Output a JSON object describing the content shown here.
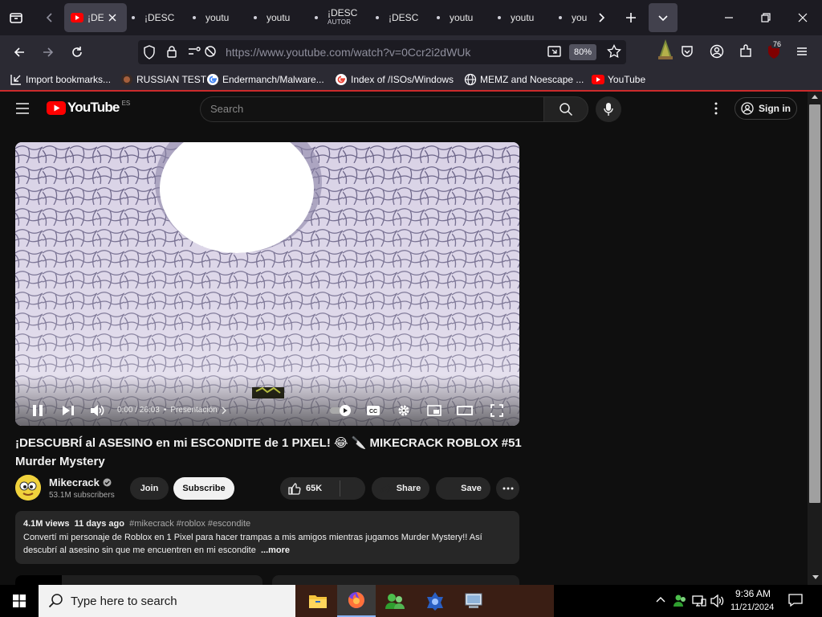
{
  "browser": {
    "tabs": [
      {
        "title": "¡DE",
        "active": true
      },
      {
        "title": "¡DESC"
      },
      {
        "title": "youtu"
      },
      {
        "title": "youtu"
      },
      {
        "title": "¡DESC",
        "subtitle": "AUTOR"
      },
      {
        "title": "¡DESC"
      },
      {
        "title": "youtu"
      },
      {
        "title": "youtu"
      },
      {
        "title": "you"
      }
    ],
    "url_host": "https://www.youtube.com",
    "url_path": "/watch?v=0Ccr2i2dWUk",
    "zoom": "80%",
    "extension_badge": "76",
    "bookmarks": [
      {
        "label": "Import bookmarks...",
        "icon": "import-icon"
      },
      {
        "label": "RUSSIAN TEST",
        "icon": "github-icon"
      },
      {
        "label": "Endermanch/Malware...",
        "icon": "google-icon"
      },
      {
        "label": "Index of /ISOs/Windows",
        "icon": "google-icon"
      },
      {
        "label": "MEMZ and Noescape ...",
        "icon": "globe-icon"
      },
      {
        "label": "YouTube",
        "icon": "youtube-icon"
      }
    ]
  },
  "youtube": {
    "logo_text": "YouTube",
    "region": "ES",
    "search_placeholder": "Search",
    "sign_in": "Sign in",
    "player": {
      "time": "0:00 / 26:03",
      "chapter": "Presentación",
      "progress": 0
    },
    "video_title": "¡DESCUBRÍ al ASESINO en mi ESCONDITE de 1 PIXEL! 😂 🔪 MIKECRACK ROBLOX #51 Murder Mystery",
    "channel": {
      "name": "Mikecrack",
      "subscribers": "53.1M subscribers",
      "join": "Join",
      "subscribe": "Subscribe"
    },
    "actions": {
      "likes": "65K",
      "share": "Share",
      "save": "Save"
    },
    "description": {
      "views": "4.1M views",
      "age": "11 days ago",
      "tags": "#mikecrack #roblox #escondite",
      "text": "Convertí mi personaje de Roblox en 1 Pixel para hacer trampas a mis amigos mientras jugamos Murder Mystery!! Así descubrí al asesino sin que me encuentren en mi escondite",
      "more": "...more"
    }
  },
  "taskbar": {
    "search_placeholder": "Type here to search",
    "time": "9:36 AM",
    "date": "11/21/2024"
  },
  "colors": {
    "youtube_red": "#ff0000",
    "browser_bg": "#1c1b22",
    "toolbar_bg": "#2b2a33",
    "page_bg": "#0f0f0f"
  }
}
